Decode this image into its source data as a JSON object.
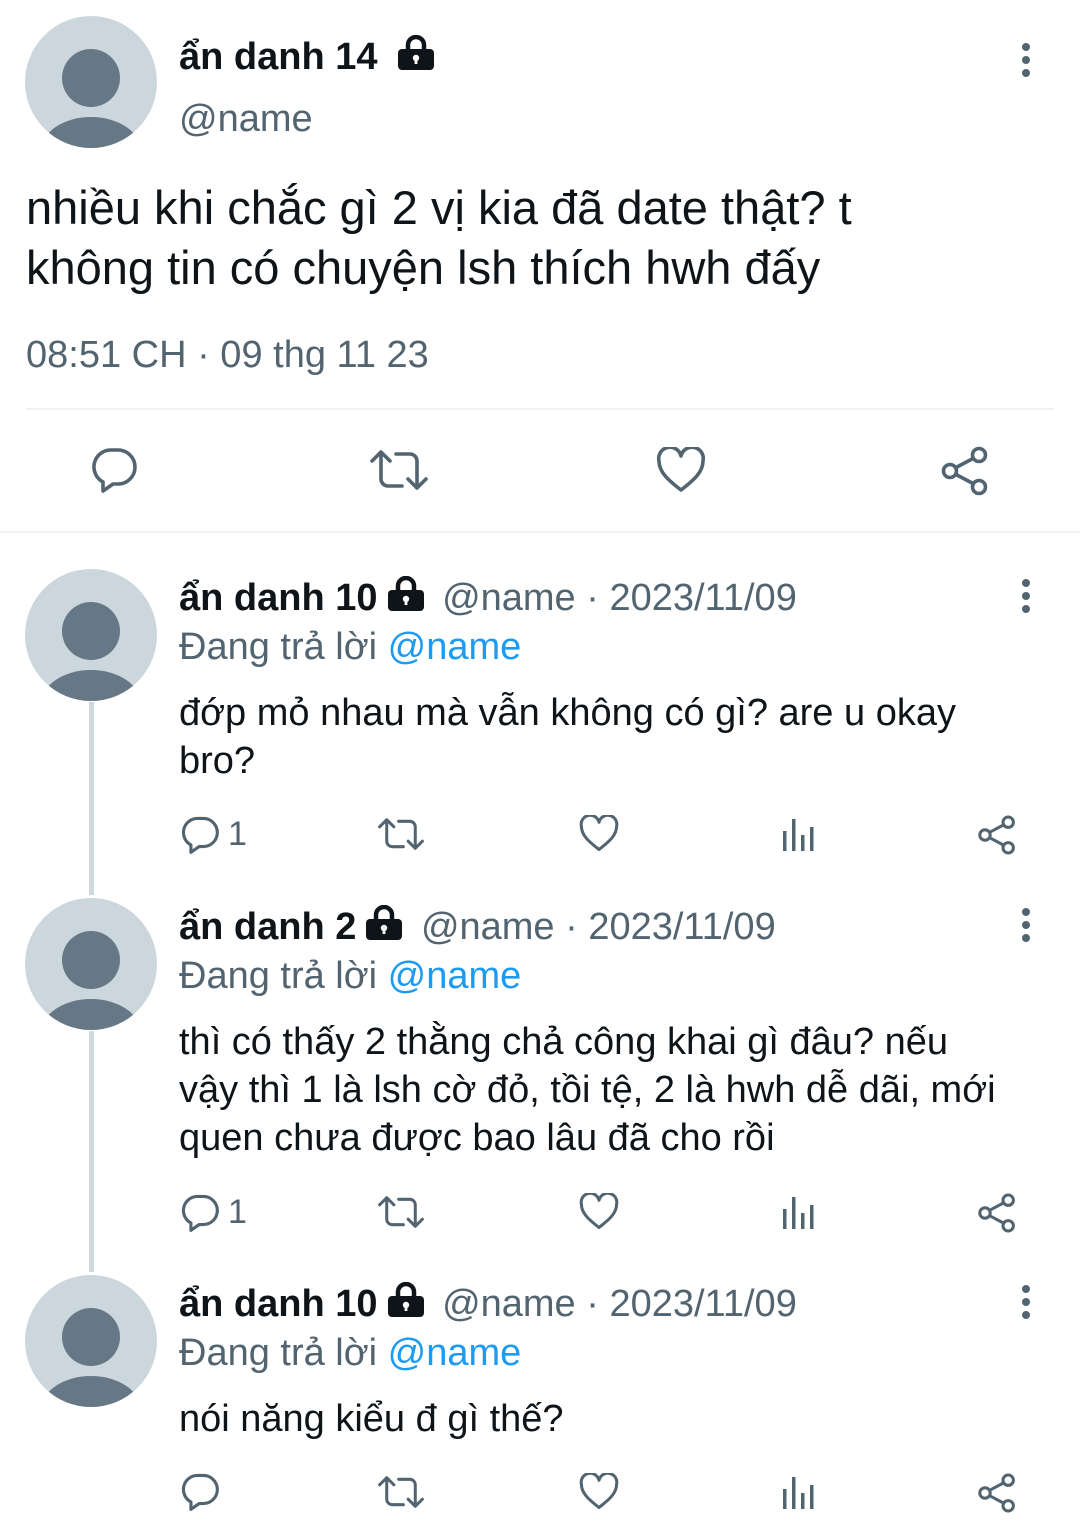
{
  "main_tweet": {
    "author": "ẩn danh 14",
    "handle": "@name",
    "text_line1": "nhiều khi chắc gì 2 vị kia đã date thật? t",
    "text_line2": "không tin có chuyện lsh thích hwh đấy",
    "timestamp": "08:51 CH · 09 thg 11 23"
  },
  "replies": [
    {
      "author": "ẩn danh 10",
      "meta": "@name · 2023/11/09",
      "replying_prefix": "Đang trả lời ",
      "replying_to": "@name",
      "lines": [
        "đớp mỏ nhau mà vẫn không có gì? are u okay",
        "bro?"
      ],
      "reply_count": "1"
    },
    {
      "author": "ẩn danh 2",
      "meta": "@name · 2023/11/09",
      "replying_prefix": "Đang trả lời ",
      "replying_to": "@name",
      "lines": [
        "thì có thấy 2 thằng chả công khai gì đâu? nếu",
        "vậy thì 1 là lsh cờ đỏ, tồi tệ, 2 là hwh dễ dãi, mới",
        "quen chưa được bao lâu đã cho rồi"
      ],
      "reply_count": "1"
    },
    {
      "author": "ẩn danh 10",
      "meta": "@name · 2023/11/09",
      "replying_prefix": "Đang trả lời ",
      "replying_to": "@name",
      "lines": [
        "nói năng kiểu đ gì thế?"
      ],
      "reply_count": ""
    }
  ],
  "icons": {
    "reply": "speech-bubble-icon",
    "retweet": "retweet-icon",
    "like": "heart-icon",
    "views": "bar-chart-icon",
    "share": "share-icon",
    "more": "more-vertical-icon",
    "lock": "lock-icon"
  },
  "colors": {
    "text": "#0f1419",
    "muted": "#536471",
    "link": "#1d9bf0",
    "avatar": "#ccd6dd",
    "avatar_figure": "#667786"
  }
}
